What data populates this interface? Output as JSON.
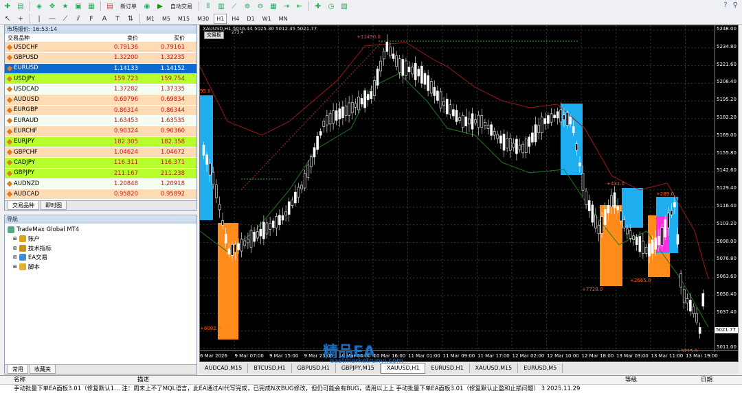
{
  "toolbar": {
    "new_order": "新订单",
    "auto_trade": "自动交易",
    "timeframes": [
      "M1",
      "M5",
      "M15",
      "M30",
      "H1",
      "H4",
      "D1",
      "W1",
      "MN"
    ],
    "active_timeframe": "H1"
  },
  "market_watch": {
    "title": "市场报价: 16:53:14",
    "col_symbol": "交易品种",
    "col_bid": "卖价",
    "col_ask": "买价",
    "rows": [
      {
        "symbol": "USDCHF",
        "bid": "0.79136",
        "ask": "0.79161",
        "bg": "#fddcb5",
        "color": "#c8161c"
      },
      {
        "symbol": "GBPUSD",
        "bid": "1.32200",
        "ask": "1.32235",
        "bg": "#fddcb5",
        "color": "#c8161c"
      },
      {
        "symbol": "EURUSD",
        "bid": "1.14133",
        "ask": "1.14152",
        "bg": "#0a6cd1",
        "color": "#ffffff"
      },
      {
        "symbol": "USDJPY",
        "bid": "159.723",
        "ask": "159.754",
        "bg": "#b6ff2c",
        "color": "#c8161c"
      },
      {
        "symbol": "USDCAD",
        "bid": "1.37282",
        "ask": "1.37335",
        "bg": "#f3fdf1",
        "color": "#c8161c"
      },
      {
        "symbol": "AUDUSD",
        "bid": "0.69796",
        "ask": "0.69834",
        "bg": "#fddcb5",
        "color": "#c8161c"
      },
      {
        "symbol": "EURGBP",
        "bid": "0.86314",
        "ask": "0.86344",
        "bg": "#fddcb5",
        "color": "#c8161c"
      },
      {
        "symbol": "EURAUD",
        "bid": "1.63453",
        "ask": "1.63535",
        "bg": "#f3fdf1",
        "color": "#c8161c"
      },
      {
        "symbol": "EURCHF",
        "bid": "0.90324",
        "ask": "0.90360",
        "bg": "#fddcb5",
        "color": "#c8161c"
      },
      {
        "symbol": "EURJPY",
        "bid": "182.305",
        "ask": "182.358",
        "bg": "#b6ff2c",
        "color": "#c8161c"
      },
      {
        "symbol": "GBPCHF",
        "bid": "1.04624",
        "ask": "1.04672",
        "bg": "#fddcb5",
        "color": "#c8161c"
      },
      {
        "symbol": "CADJPY",
        "bid": "116.311",
        "ask": "116.371",
        "bg": "#b6ff2c",
        "color": "#c8161c"
      },
      {
        "symbol": "GBPJPY",
        "bid": "211.167",
        "ask": "211.238",
        "bg": "#b6ff2c",
        "color": "#c8161c"
      },
      {
        "symbol": "AUDNZD",
        "bid": "1.20848",
        "ask": "1.20918",
        "bg": "#f3fdf1",
        "color": "#c8161c"
      },
      {
        "symbol": "AUDCAD",
        "bid": "0.95820",
        "ask": "0.95892",
        "bg": "#fddcb5",
        "color": "#c8161c"
      }
    ],
    "tabs": [
      "交易品种",
      "即时图"
    ]
  },
  "navigator": {
    "title": "导航",
    "root": "TradeMax Global MT4",
    "items": [
      "账户",
      "技术指标",
      "EA交易",
      "脚本"
    ],
    "tabs": [
      "常用",
      "收藏夹"
    ]
  },
  "chart": {
    "symbol_line": "XAUUSD,H1  5016.44 5025.30 5012.45 5021.77",
    "trade_button": "交易板",
    "small_value": "273.4",
    "price_labels": [
      "5248.00",
      "5234.80",
      "5221.60",
      "5208.40",
      "5195.20",
      "5182.20",
      "5169.00",
      "5155.80",
      "5142.60",
      "5129.40",
      "5116.40",
      "5103.20",
      "5090.00",
      "5076.80",
      "5063.60",
      "5050.40",
      "5037.40",
      "5024.20",
      "5011.00"
    ],
    "current_price": "5021.77",
    "time_labels": [
      "6 Mar 2026",
      "9 Mar 07:00",
      "9 Mar 15:00",
      "9 Mar 23:00",
      "10 Mar 08:00",
      "10 Mar 16:00",
      "11 Mar 01:00",
      "11 Mar 09:00",
      "11 Mar 17:00",
      "12 Mar 02:00",
      "12 Mar 10:00",
      "12 Mar 18:00",
      "13 Mar 03:00",
      "13 Mar 11:00",
      "13 Mar 19:00"
    ],
    "annotations": [
      "+11430.0",
      "+6082.0",
      "+431.0",
      "+289.0",
      "+7728.0",
      "+2665.0",
      "+3215.0",
      "95.0"
    ]
  },
  "watermark": {
    "title": "精品EA",
    "url": "eastmarketrunyi.com"
  },
  "chart_tabs": [
    "AUDCAD,M15",
    "BTCUSD,H1",
    "GBPUSD,H1",
    "GBPJPY,M15",
    "XAUUSD,H1",
    "EURUSD,H1",
    "XAUUSD,M15",
    "EURUSD,M5"
  ],
  "active_chart_tab": "XAUUSD,H1",
  "bottom_panel": {
    "col_name": "名称",
    "col_desc": "描述",
    "col_level": "等级",
    "col_date": "日期",
    "row_text": "手动批量下单EA面板3.01（修复默认1…   注：周末上不了MQL语言，此EA通过AI代写完成，已完成N次BUG修改，但仍可能会有BUG，请用以上上 手动批量下单EA面板3.01（修复默认止盈和止损问题）  3   2025.11.29"
  }
}
